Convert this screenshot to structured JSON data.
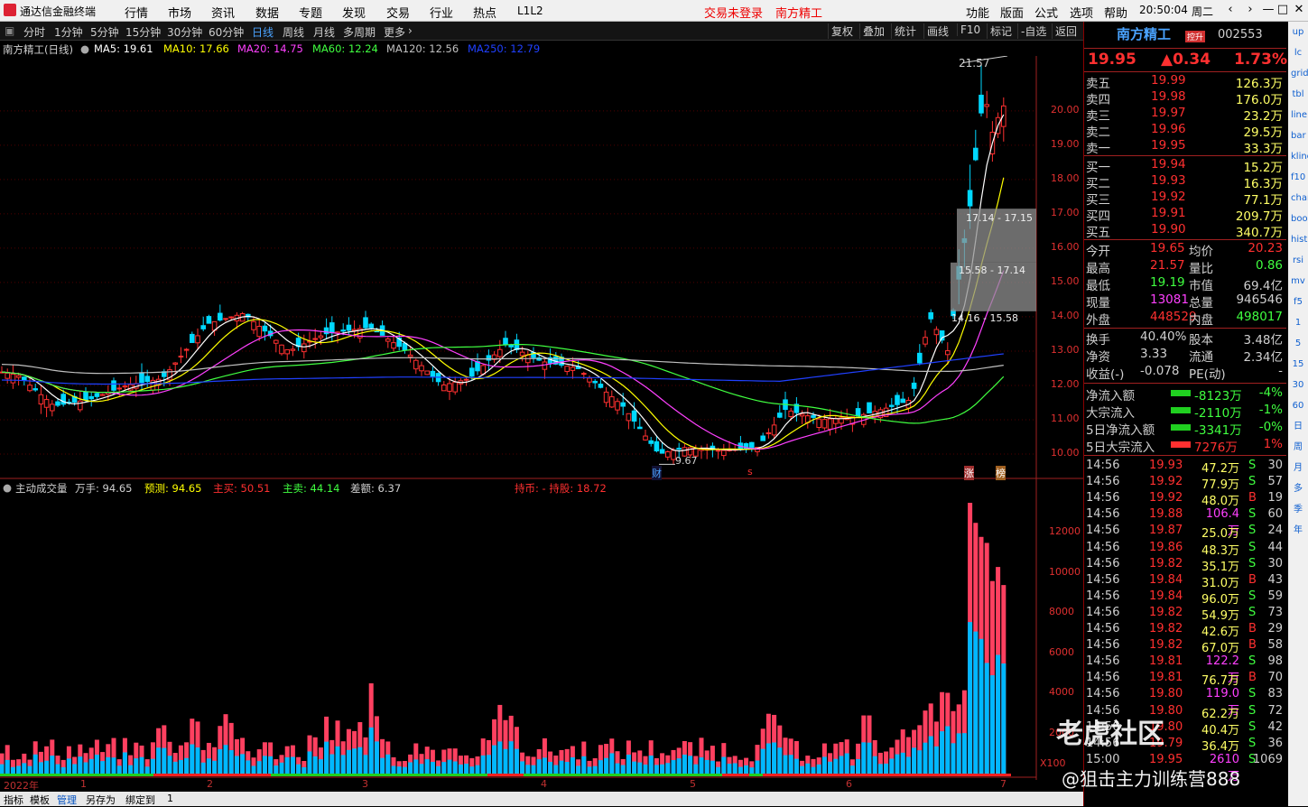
{
  "menu": {
    "app_title": "通达信金融终端",
    "items": [
      "行情",
      "市场",
      "资讯",
      "数据",
      "专题",
      "发现",
      "交易",
      "行业",
      "热点",
      "L1L2"
    ],
    "status_login": "交易未登录",
    "status_stock": "南方精工",
    "right_items": [
      "功能",
      "版面",
      "公式",
      "选项",
      "帮助"
    ],
    "clock": "20:50:04",
    "weekday": "周二"
  },
  "periods": [
    "分时",
    "1分钟",
    "5分钟",
    "15分钟",
    "30分钟",
    "60分钟",
    "日线",
    "周线",
    "月线",
    "多周期",
    "更多"
  ],
  "active_period": "日线",
  "toolbar": [
    "复权",
    "叠加",
    "统计",
    "画线",
    "F10",
    "标记",
    "-自选",
    "返回"
  ],
  "ma_legend": {
    "stock": "南方精工(日线)",
    "items": [
      {
        "label": "MA5: 19.61",
        "color": "#ffffff"
      },
      {
        "label": "MA10: 17.66",
        "color": "#ffff00"
      },
      {
        "label": "MA20: 14.75",
        "color": "#ff40ff"
      },
      {
        "label": "MA60: 12.24",
        "color": "#40ff40"
      },
      {
        "label": "MA120: 12.56",
        "color": "#c0c0c0"
      },
      {
        "label": "MA250: 12.79",
        "color": "#2040ff"
      }
    ]
  },
  "price_axis": [
    "20.00",
    "19.00",
    "18.00",
    "17.00",
    "16.00",
    "15.00",
    "14.00",
    "13.00",
    "12.00",
    "11.00",
    "10.00"
  ],
  "annotations": {
    "high": "21.57",
    "low": "9.67",
    "box1": "17.14 - 17.15",
    "box2": "15.58 - 17.14",
    "box3": "14.16 - 15.58",
    "tag_cai": "财",
    "tag_s": "s",
    "tag_zhang": "涨",
    "tag_bang": "榜"
  },
  "volume_legend": [
    {
      "label": "主动成交量",
      "color": "#d0d0d0"
    },
    {
      "label": "万手: 94.65",
      "color": "#d0d0d0"
    },
    {
      "label": "预测: 94.65",
      "color": "#ffff00"
    },
    {
      "label": "主买: 50.51",
      "color": "#ff3030"
    },
    {
      "label": "主卖: 44.14",
      "color": "#40ff40"
    },
    {
      "label": "差额: 6.37",
      "color": "#d0d0d0"
    },
    {
      "label": "持币: -  持股: 18.72",
      "color": "#ff3030"
    }
  ],
  "vol_axis": [
    "12000",
    "10000",
    "8000",
    "6000",
    "4000",
    "2000",
    "X100"
  ],
  "x_axis": [
    "2022年",
    "1",
    "2",
    "3",
    "4",
    "5",
    "6",
    "7"
  ],
  "bottom_tabs": [
    "指标",
    "模板",
    "管理",
    "另存为",
    "绑定到",
    "1"
  ],
  "quote": {
    "name": "南方精工",
    "badge": "控升",
    "code": "002553",
    "price": "19.95",
    "change": "▲0.34",
    "pct": "1.73%",
    "asks": [
      {
        "label": "卖五",
        "price": "19.99",
        "vol": "126.3万"
      },
      {
        "label": "卖四",
        "price": "19.98",
        "vol": "176.0万"
      },
      {
        "label": "卖三",
        "price": "19.97",
        "vol": "23.2万"
      },
      {
        "label": "卖二",
        "price": "19.96",
        "vol": "29.5万"
      },
      {
        "label": "卖一",
        "price": "19.95",
        "vol": "33.3万"
      }
    ],
    "bids": [
      {
        "label": "买一",
        "price": "19.94",
        "vol": "15.2万"
      },
      {
        "label": "买二",
        "price": "19.93",
        "vol": "16.3万"
      },
      {
        "label": "买三",
        "price": "19.92",
        "vol": "77.1万"
      },
      {
        "label": "买四",
        "price": "19.91",
        "vol": "209.7万"
      },
      {
        "label": "买五",
        "price": "19.90",
        "vol": "340.7万"
      }
    ],
    "stats": [
      {
        "l1": "今开",
        "v1": "19.65",
        "c1": "#ff3030",
        "l2": "均价",
        "v2": "20.23",
        "c2": "#ff3030"
      },
      {
        "l1": "最高",
        "v1": "21.57",
        "c1": "#ff3030",
        "l2": "量比",
        "v2": "0.86",
        "c2": "#40ff40"
      },
      {
        "l1": "最低",
        "v1": "19.19",
        "c1": "#40ff40",
        "l2": "市值",
        "v2": "69.4亿",
        "c2": "#d0d0d0"
      },
      {
        "l1": "现量",
        "v1": "13081",
        "c1": "#ff40ff",
        "l2": "总量",
        "v2": "946546",
        "c2": "#d0d0d0"
      },
      {
        "l1": "外盘",
        "v1": "448529",
        "c1": "#ff3030",
        "l2": "内盘",
        "v2": "498017",
        "c2": "#40ff40"
      }
    ],
    "stats2": [
      {
        "l1": "换手",
        "v1": "40.40%",
        "l2": "股本",
        "v2": "3.48亿"
      },
      {
        "l1": "净资",
        "v1": "3.33",
        "l2": "流通",
        "v2": "2.34亿"
      },
      {
        "l1": "收益(-)",
        "v1": "-0.078",
        "l2": "PE(动)",
        "v2": "-"
      }
    ],
    "flows": [
      {
        "label": "净流入额",
        "val": "-8123万",
        "pct": "-4%",
        "bar": "#20d020"
      },
      {
        "label": "大宗流入",
        "val": "-2110万",
        "pct": "-1%",
        "bar": "#20d020"
      },
      {
        "label": "5日净流入额",
        "val": "-3341万",
        "pct": "-0%",
        "bar": "#20d020"
      },
      {
        "label": "5日大宗流入",
        "val": "7276万",
        "pct": "1%",
        "bar": "#ff3030"
      }
    ],
    "ticks": [
      {
        "t": "14:56",
        "p": "19.93",
        "v": "47.2万",
        "s": "S",
        "n": "30"
      },
      {
        "t": "14:56",
        "p": "19.92",
        "v": "77.9万",
        "s": "S",
        "n": "57"
      },
      {
        "t": "14:56",
        "p": "19.92",
        "v": "48.0万",
        "s": "B",
        "n": "19"
      },
      {
        "t": "14:56",
        "p": "19.88",
        "v": "106.4万",
        "s": "S",
        "n": "60"
      },
      {
        "t": "14:56",
        "p": "19.87",
        "v": "25.0万",
        "s": "S",
        "n": "24"
      },
      {
        "t": "14:56",
        "p": "19.86",
        "v": "48.3万",
        "s": "S",
        "n": "44"
      },
      {
        "t": "14:56",
        "p": "19.82",
        "v": "35.1万",
        "s": "S",
        "n": "30"
      },
      {
        "t": "14:56",
        "p": "19.84",
        "v": "31.0万",
        "s": "B",
        "n": "43"
      },
      {
        "t": "14:56",
        "p": "19.84",
        "v": "96.0万",
        "s": "S",
        "n": "59"
      },
      {
        "t": "14:56",
        "p": "19.82",
        "v": "54.9万",
        "s": "S",
        "n": "73"
      },
      {
        "t": "14:56",
        "p": "19.82",
        "v": "42.6万",
        "s": "B",
        "n": "29"
      },
      {
        "t": "14:56",
        "p": "19.82",
        "v": "67.0万",
        "s": "B",
        "n": "58"
      },
      {
        "t": "14:56",
        "p": "19.81",
        "v": "122.2万",
        "s": "S",
        "n": "98"
      },
      {
        "t": "14:56",
        "p": "19.81",
        "v": "76.7万",
        "s": "B",
        "n": "70"
      },
      {
        "t": "14:56",
        "p": "19.80",
        "v": "119.0万",
        "s": "S",
        "n": "83"
      },
      {
        "t": "14:56",
        "p": "19.80",
        "v": "62.2万",
        "s": "S",
        "n": "72"
      },
      {
        "t": "14:56",
        "p": "19.80",
        "v": "40.4万",
        "s": "S",
        "n": "42"
      },
      {
        "t": "14:56",
        "p": "19.79",
        "v": "36.4万",
        "s": "S",
        "n": "36"
      },
      {
        "t": "15:00",
        "p": "19.95",
        "v": "2610万",
        "s": "S",
        "n": "1069"
      }
    ]
  },
  "side_icons": [
    "up",
    "lc",
    "grid",
    "tbl",
    "line",
    "bar",
    "kline",
    "f10",
    "chart",
    "book",
    "hist",
    "rsi",
    "mv",
    "f5",
    "1",
    "5",
    "15",
    "30",
    "60",
    "日",
    "周",
    "月",
    "多",
    "季",
    "年"
  ],
  "watermark": "老虎社区",
  "watermark2": "@狙击主力训练营888",
  "colors": {
    "up": "#ff3030",
    "down": "#00c0ff",
    "bg": "#000000",
    "grid": "#800000"
  }
}
